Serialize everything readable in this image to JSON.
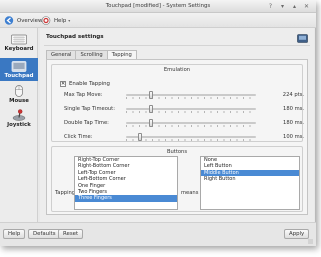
{
  "window": {
    "title": "Touchpad [modified] - System Settings"
  },
  "toolbar": {
    "overview_label": "Overview",
    "help_label": "Help"
  },
  "sidebar": {
    "items": [
      {
        "label": "Keyboard"
      },
      {
        "label": "Touchpad"
      },
      {
        "label": "Mouse"
      },
      {
        "label": "Joystick"
      }
    ]
  },
  "page": {
    "title": "Touchpad settings"
  },
  "tabs": [
    {
      "label": "General"
    },
    {
      "label": "Scrolling"
    },
    {
      "label": "Tapping"
    }
  ],
  "emulation": {
    "title": "Emulation",
    "enable_tapping_label": "Enable Tapping",
    "enable_tapping_checked": true,
    "sliders": [
      {
        "label": "Max Tap Move:",
        "value": "224 pts.",
        "position": 0.2
      },
      {
        "label": "Single Tap Timeout:",
        "value": "180 ms.",
        "position": 0.2
      },
      {
        "label": "Double Tap Time:",
        "value": "180 ms.",
        "position": 0.2
      },
      {
        "label": "Click Time:",
        "value": "100 ms.",
        "position": 0.1
      }
    ]
  },
  "buttons_group": {
    "title": "Buttons",
    "tapping_label": "Tapping",
    "means_label": "means",
    "tap_list": [
      "Right-Top Corner",
      "Right-Bottom Corner",
      "Left-Top Corner",
      "Left-Bottom Corner",
      "One Finger",
      "Two Fingers",
      "Three Fingers"
    ],
    "tap_selected": "Three Fingers",
    "means_list": [
      "None",
      "Left Button",
      "Middle Button",
      "Right Button"
    ],
    "means_selected": "Middle Button"
  },
  "bottom": {
    "help_label": "Help",
    "defaults_label": "Defaults",
    "reset_label": "Reset",
    "apply_label": "Apply"
  },
  "colors": {
    "accent": "#3a78c2",
    "selection": "#4a8ad4"
  }
}
